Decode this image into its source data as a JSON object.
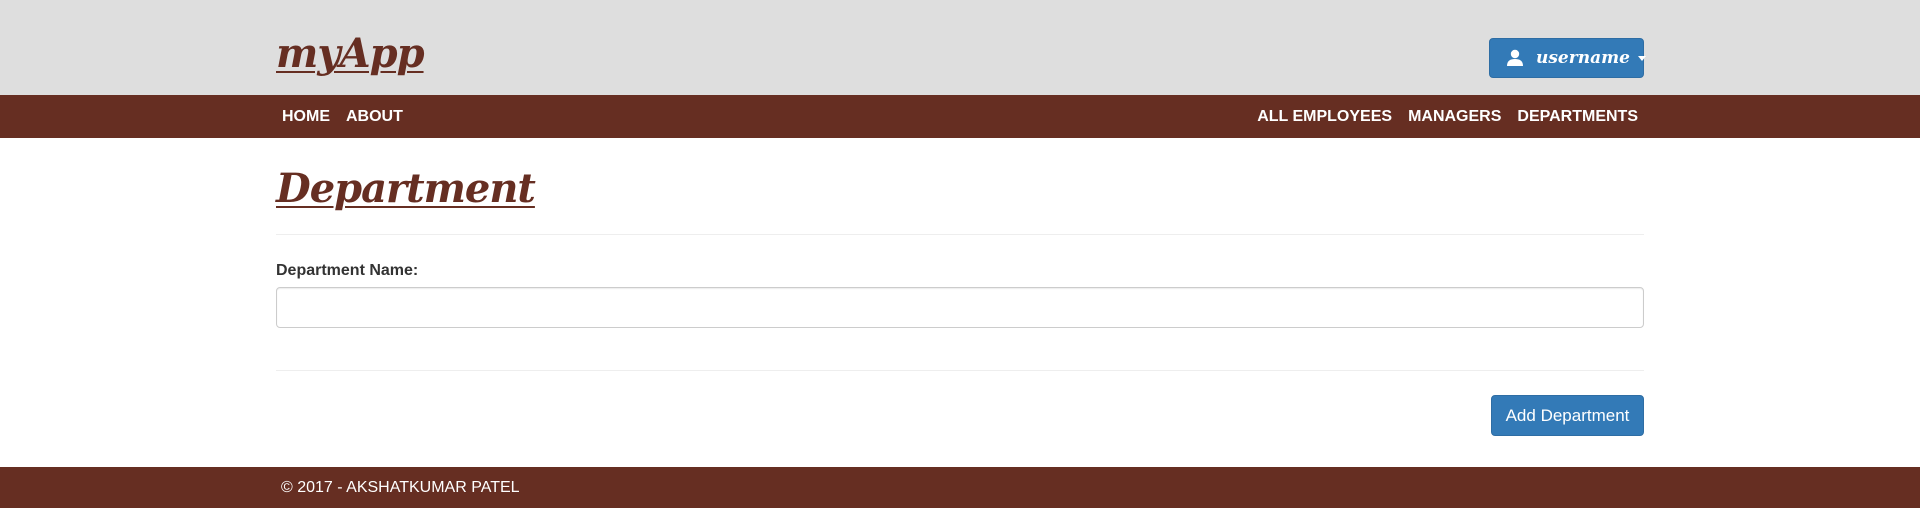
{
  "header": {
    "logo": "myApp",
    "user_menu": {
      "label": "username",
      "icon": "user-icon"
    }
  },
  "nav": {
    "left": [
      "HOME",
      "ABOUT"
    ],
    "right": [
      "ALL EMPLOYEES",
      "MANAGERS",
      "DEPARTMENTS"
    ]
  },
  "main": {
    "title": "Department",
    "form": {
      "department_name_label": "Department Name:",
      "department_name_value": "",
      "department_name_placeholder": ""
    },
    "submit_label": "Add Department"
  },
  "footer": {
    "text": "© 2017 - AKSHATKUMAR PATEL"
  },
  "colors": {
    "brand": "#662e22",
    "header_bg": "#dedede",
    "primary_button": "#337ab7"
  }
}
